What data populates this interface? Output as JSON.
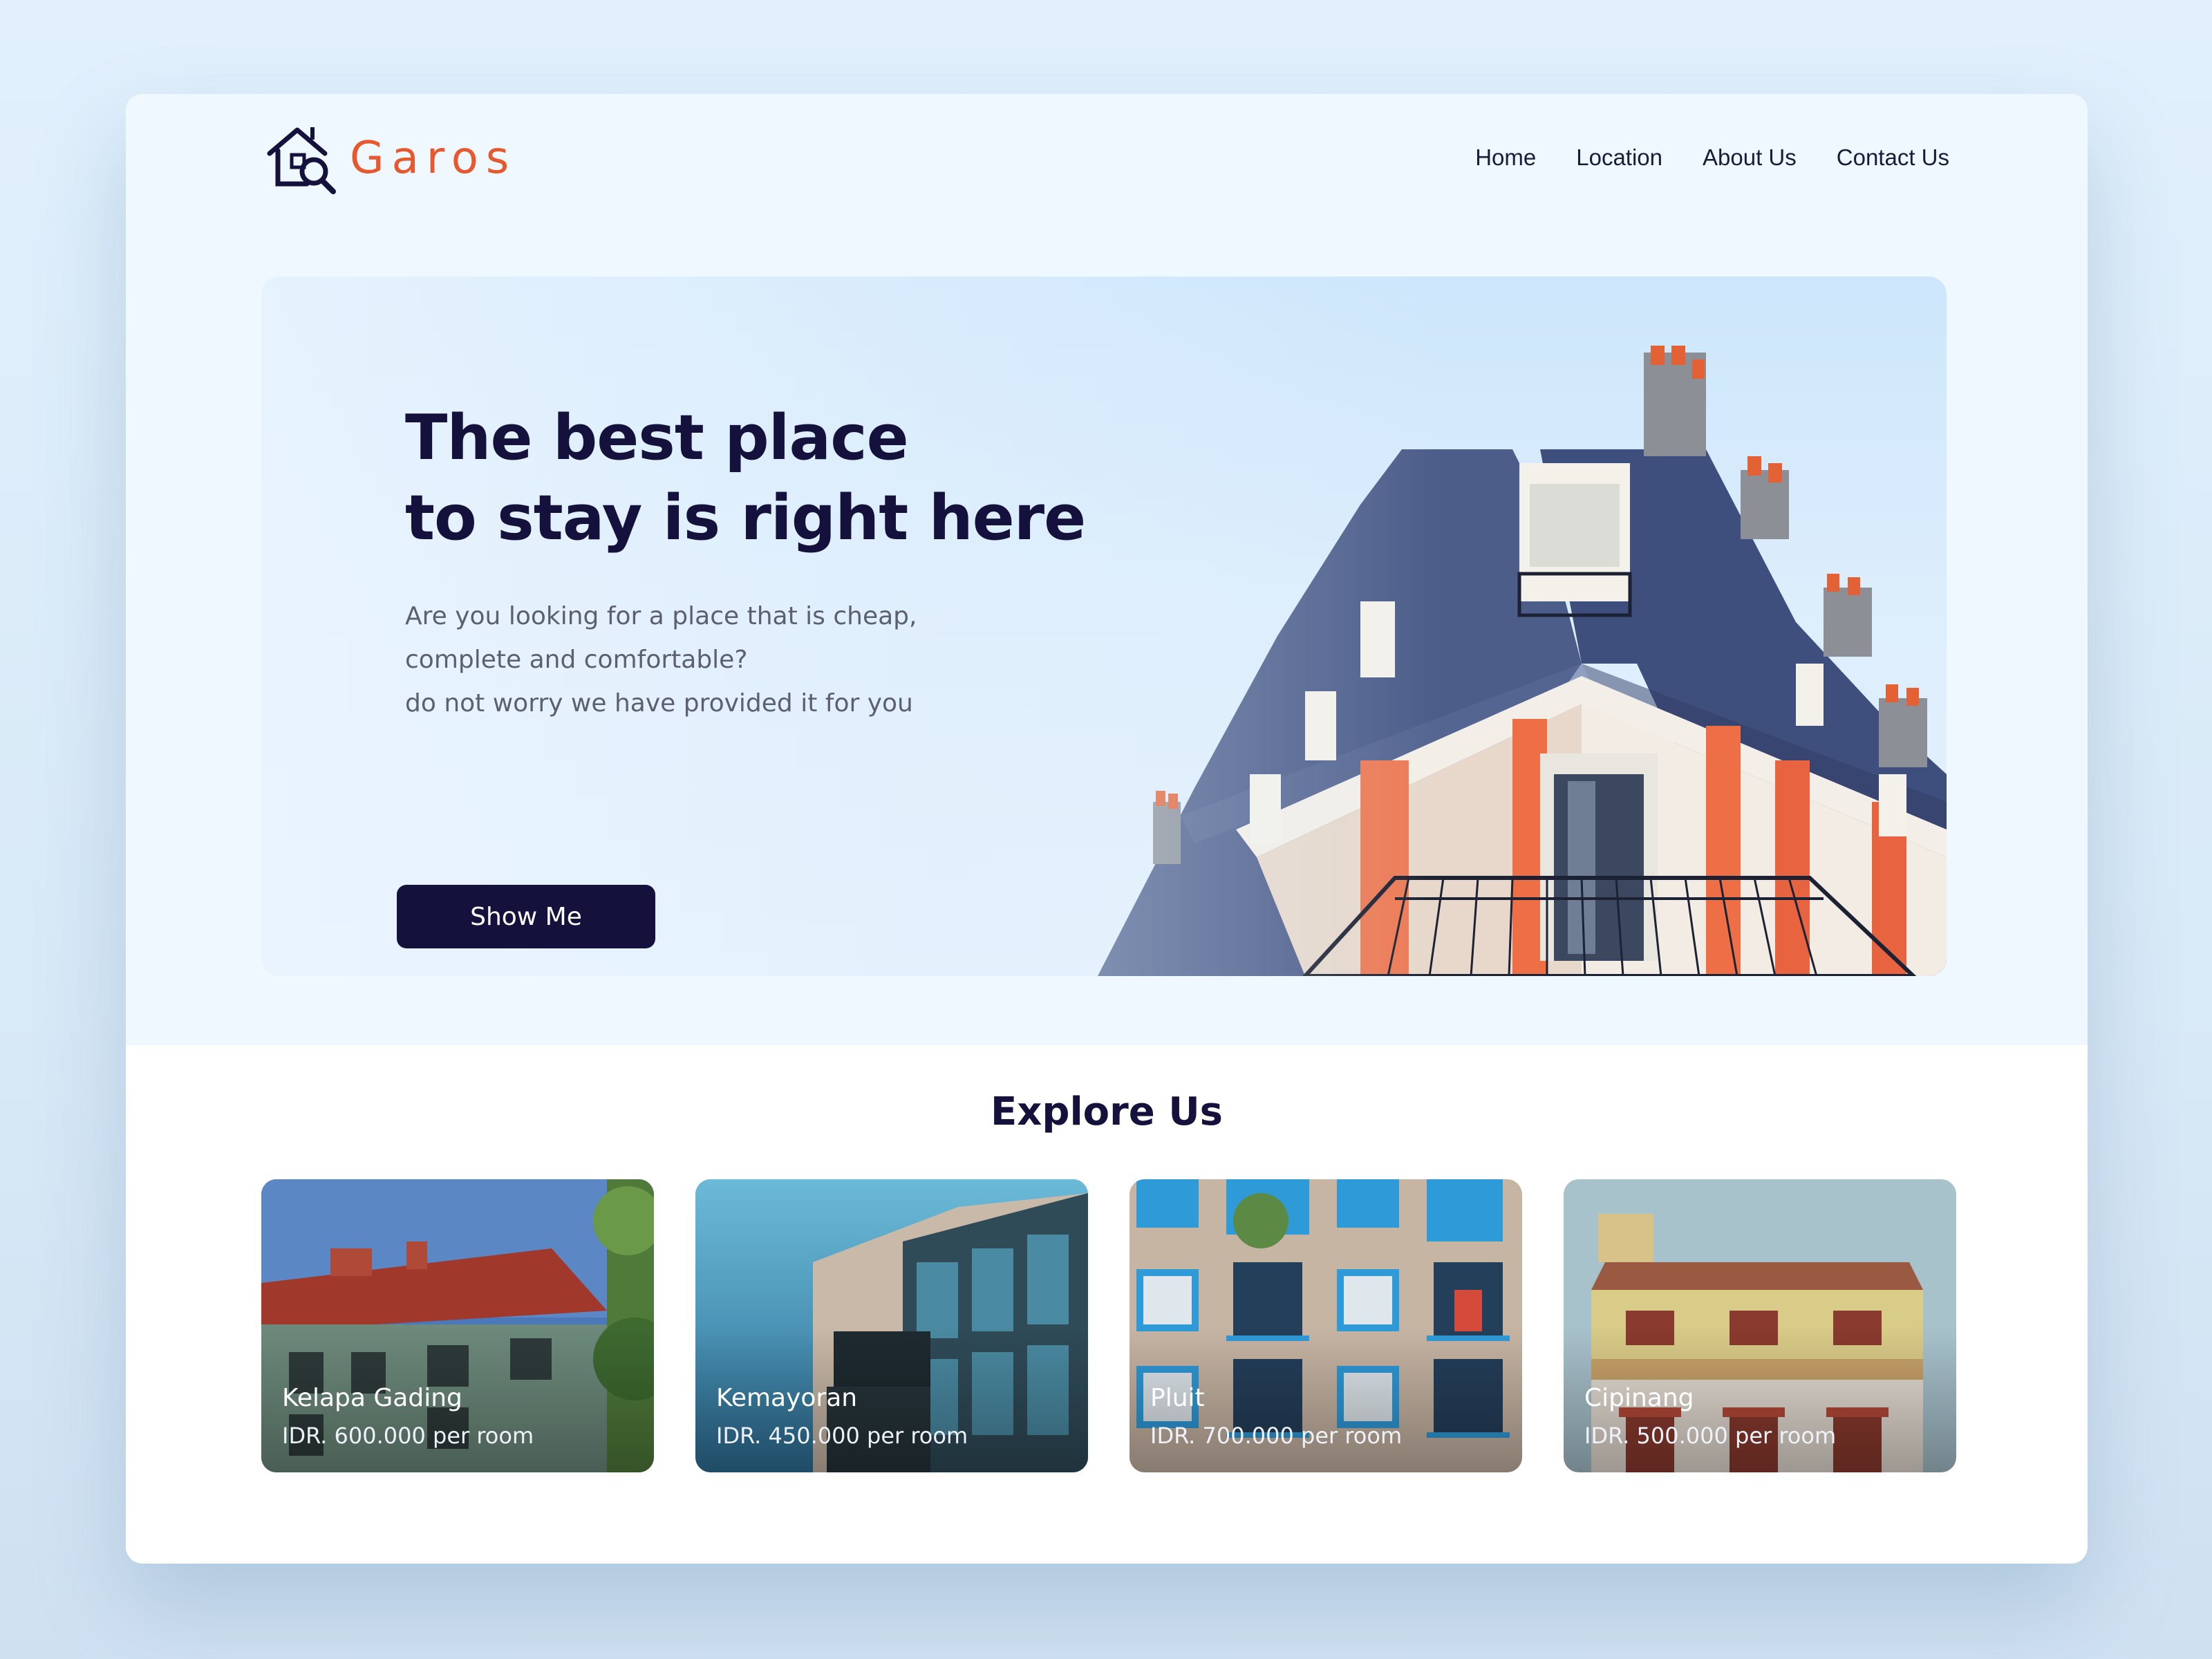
{
  "brand": {
    "name": "Garos",
    "logo_icon": "house-search-icon",
    "color": "#e8582f"
  },
  "nav": {
    "items": [
      {
        "label": "Home"
      },
      {
        "label": "Location"
      },
      {
        "label": "About Us"
      },
      {
        "label": "Contact Us"
      }
    ]
  },
  "hero": {
    "title_line1": "The best place",
    "title_line2": "to stay is right here",
    "desc_line1": "Are you looking for a place that is cheap,",
    "desc_line2": "complete and comfortable?",
    "desc_line3": "do not worry we have provided it for you",
    "button_label": "Show Me",
    "title_color": "#14113d"
  },
  "explore": {
    "title": "Explore Us",
    "cards": [
      {
        "name": "Kelapa Gading",
        "price": "IDR. 600.000 per room"
      },
      {
        "name": "Kemayoran",
        "price": "IDR. 450.000 per room"
      },
      {
        "name": "Pluit",
        "price": "IDR. 700.000 per room"
      },
      {
        "name": "Cipinang",
        "price": "IDR. 500.000 per room"
      }
    ]
  }
}
